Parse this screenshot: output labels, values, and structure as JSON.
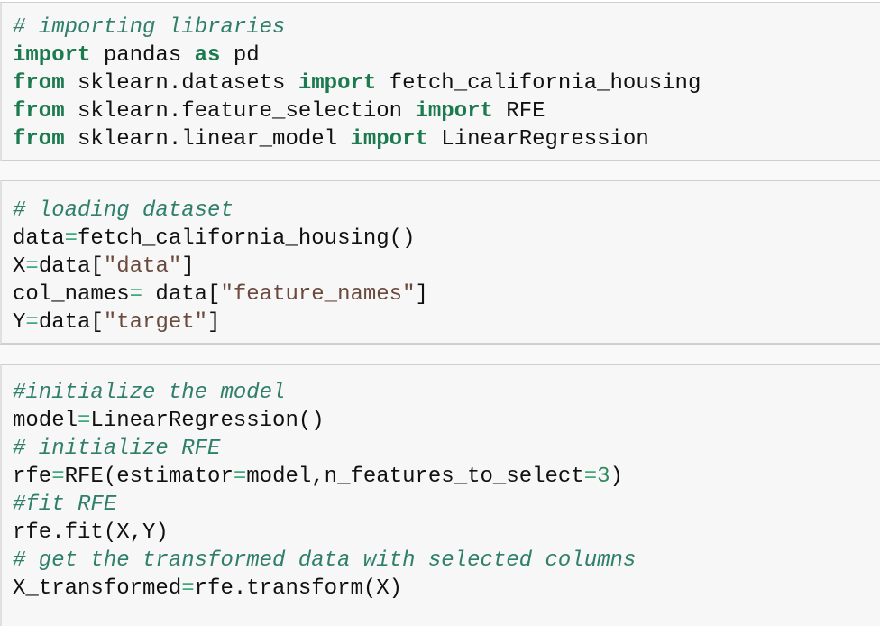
{
  "cells": [
    {
      "lines": [
        [
          {
            "t": "# importing libraries",
            "c": "cm"
          }
        ],
        [
          {
            "t": "import",
            "c": "kw"
          },
          {
            "t": " pandas ",
            "c": "nm"
          },
          {
            "t": "as",
            "c": "kw"
          },
          {
            "t": " pd",
            "c": "nm"
          }
        ],
        [
          {
            "t": "from",
            "c": "kw"
          },
          {
            "t": " sklearn.datasets ",
            "c": "nm"
          },
          {
            "t": "import",
            "c": "kw"
          },
          {
            "t": " fetch_california_housing",
            "c": "nm"
          }
        ],
        [
          {
            "t": "from",
            "c": "kw"
          },
          {
            "t": " sklearn.feature_selection ",
            "c": "nm"
          },
          {
            "t": "import",
            "c": "kw"
          },
          {
            "t": " RFE",
            "c": "nm"
          }
        ],
        [
          {
            "t": "from",
            "c": "kw"
          },
          {
            "t": " sklearn.linear_model ",
            "c": "nm"
          },
          {
            "t": "import",
            "c": "kw"
          },
          {
            "t": " LinearRegression",
            "c": "nm"
          }
        ]
      ]
    },
    {
      "lines": [
        [
          {
            "t": "# loading dataset",
            "c": "cm"
          }
        ],
        [
          {
            "t": "data",
            "c": "nm"
          },
          {
            "t": "=",
            "c": "op"
          },
          {
            "t": "fetch_california_housing()",
            "c": "nm"
          }
        ],
        [
          {
            "t": "X",
            "c": "nm"
          },
          {
            "t": "=",
            "c": "op"
          },
          {
            "t": "data[",
            "c": "nm"
          },
          {
            "t": "\"data\"",
            "c": "st"
          },
          {
            "t": "]",
            "c": "nm"
          }
        ],
        [
          {
            "t": "col_names",
            "c": "nm"
          },
          {
            "t": "=",
            "c": "op"
          },
          {
            "t": " data[",
            "c": "nm"
          },
          {
            "t": "\"feature_names\"",
            "c": "st"
          },
          {
            "t": "]",
            "c": "nm"
          }
        ],
        [
          {
            "t": "Y",
            "c": "nm"
          },
          {
            "t": "=",
            "c": "op"
          },
          {
            "t": "data[",
            "c": "nm"
          },
          {
            "t": "\"target\"",
            "c": "st"
          },
          {
            "t": "]",
            "c": "nm"
          }
        ]
      ]
    },
    {
      "lines": [
        [
          {
            "t": "#initialize the model",
            "c": "cm"
          }
        ],
        [
          {
            "t": "model",
            "c": "nm"
          },
          {
            "t": "=",
            "c": "op"
          },
          {
            "t": "LinearRegression()",
            "c": "nm"
          }
        ],
        [
          {
            "t": "# initialize RFE",
            "c": "cm"
          }
        ],
        [
          {
            "t": "rfe",
            "c": "nm"
          },
          {
            "t": "=",
            "c": "op"
          },
          {
            "t": "RFE(estimator",
            "c": "nm"
          },
          {
            "t": "=",
            "c": "op"
          },
          {
            "t": "model,n_features_to_select",
            "c": "nm"
          },
          {
            "t": "=",
            "c": "op"
          },
          {
            "t": "3",
            "c": "nu"
          },
          {
            "t": ")",
            "c": "nm"
          }
        ],
        [
          {
            "t": "#fit RFE",
            "c": "cm"
          }
        ],
        [
          {
            "t": "rfe.fit(X,Y)",
            "c": "nm"
          }
        ],
        [
          {
            "t": "# get the transformed data with selected columns",
            "c": "cm"
          }
        ],
        [
          {
            "t": "X_transformed",
            "c": "nm"
          },
          {
            "t": "=",
            "c": "op"
          },
          {
            "t": "rfe.transform(X)",
            "c": "nm"
          }
        ]
      ]
    }
  ]
}
